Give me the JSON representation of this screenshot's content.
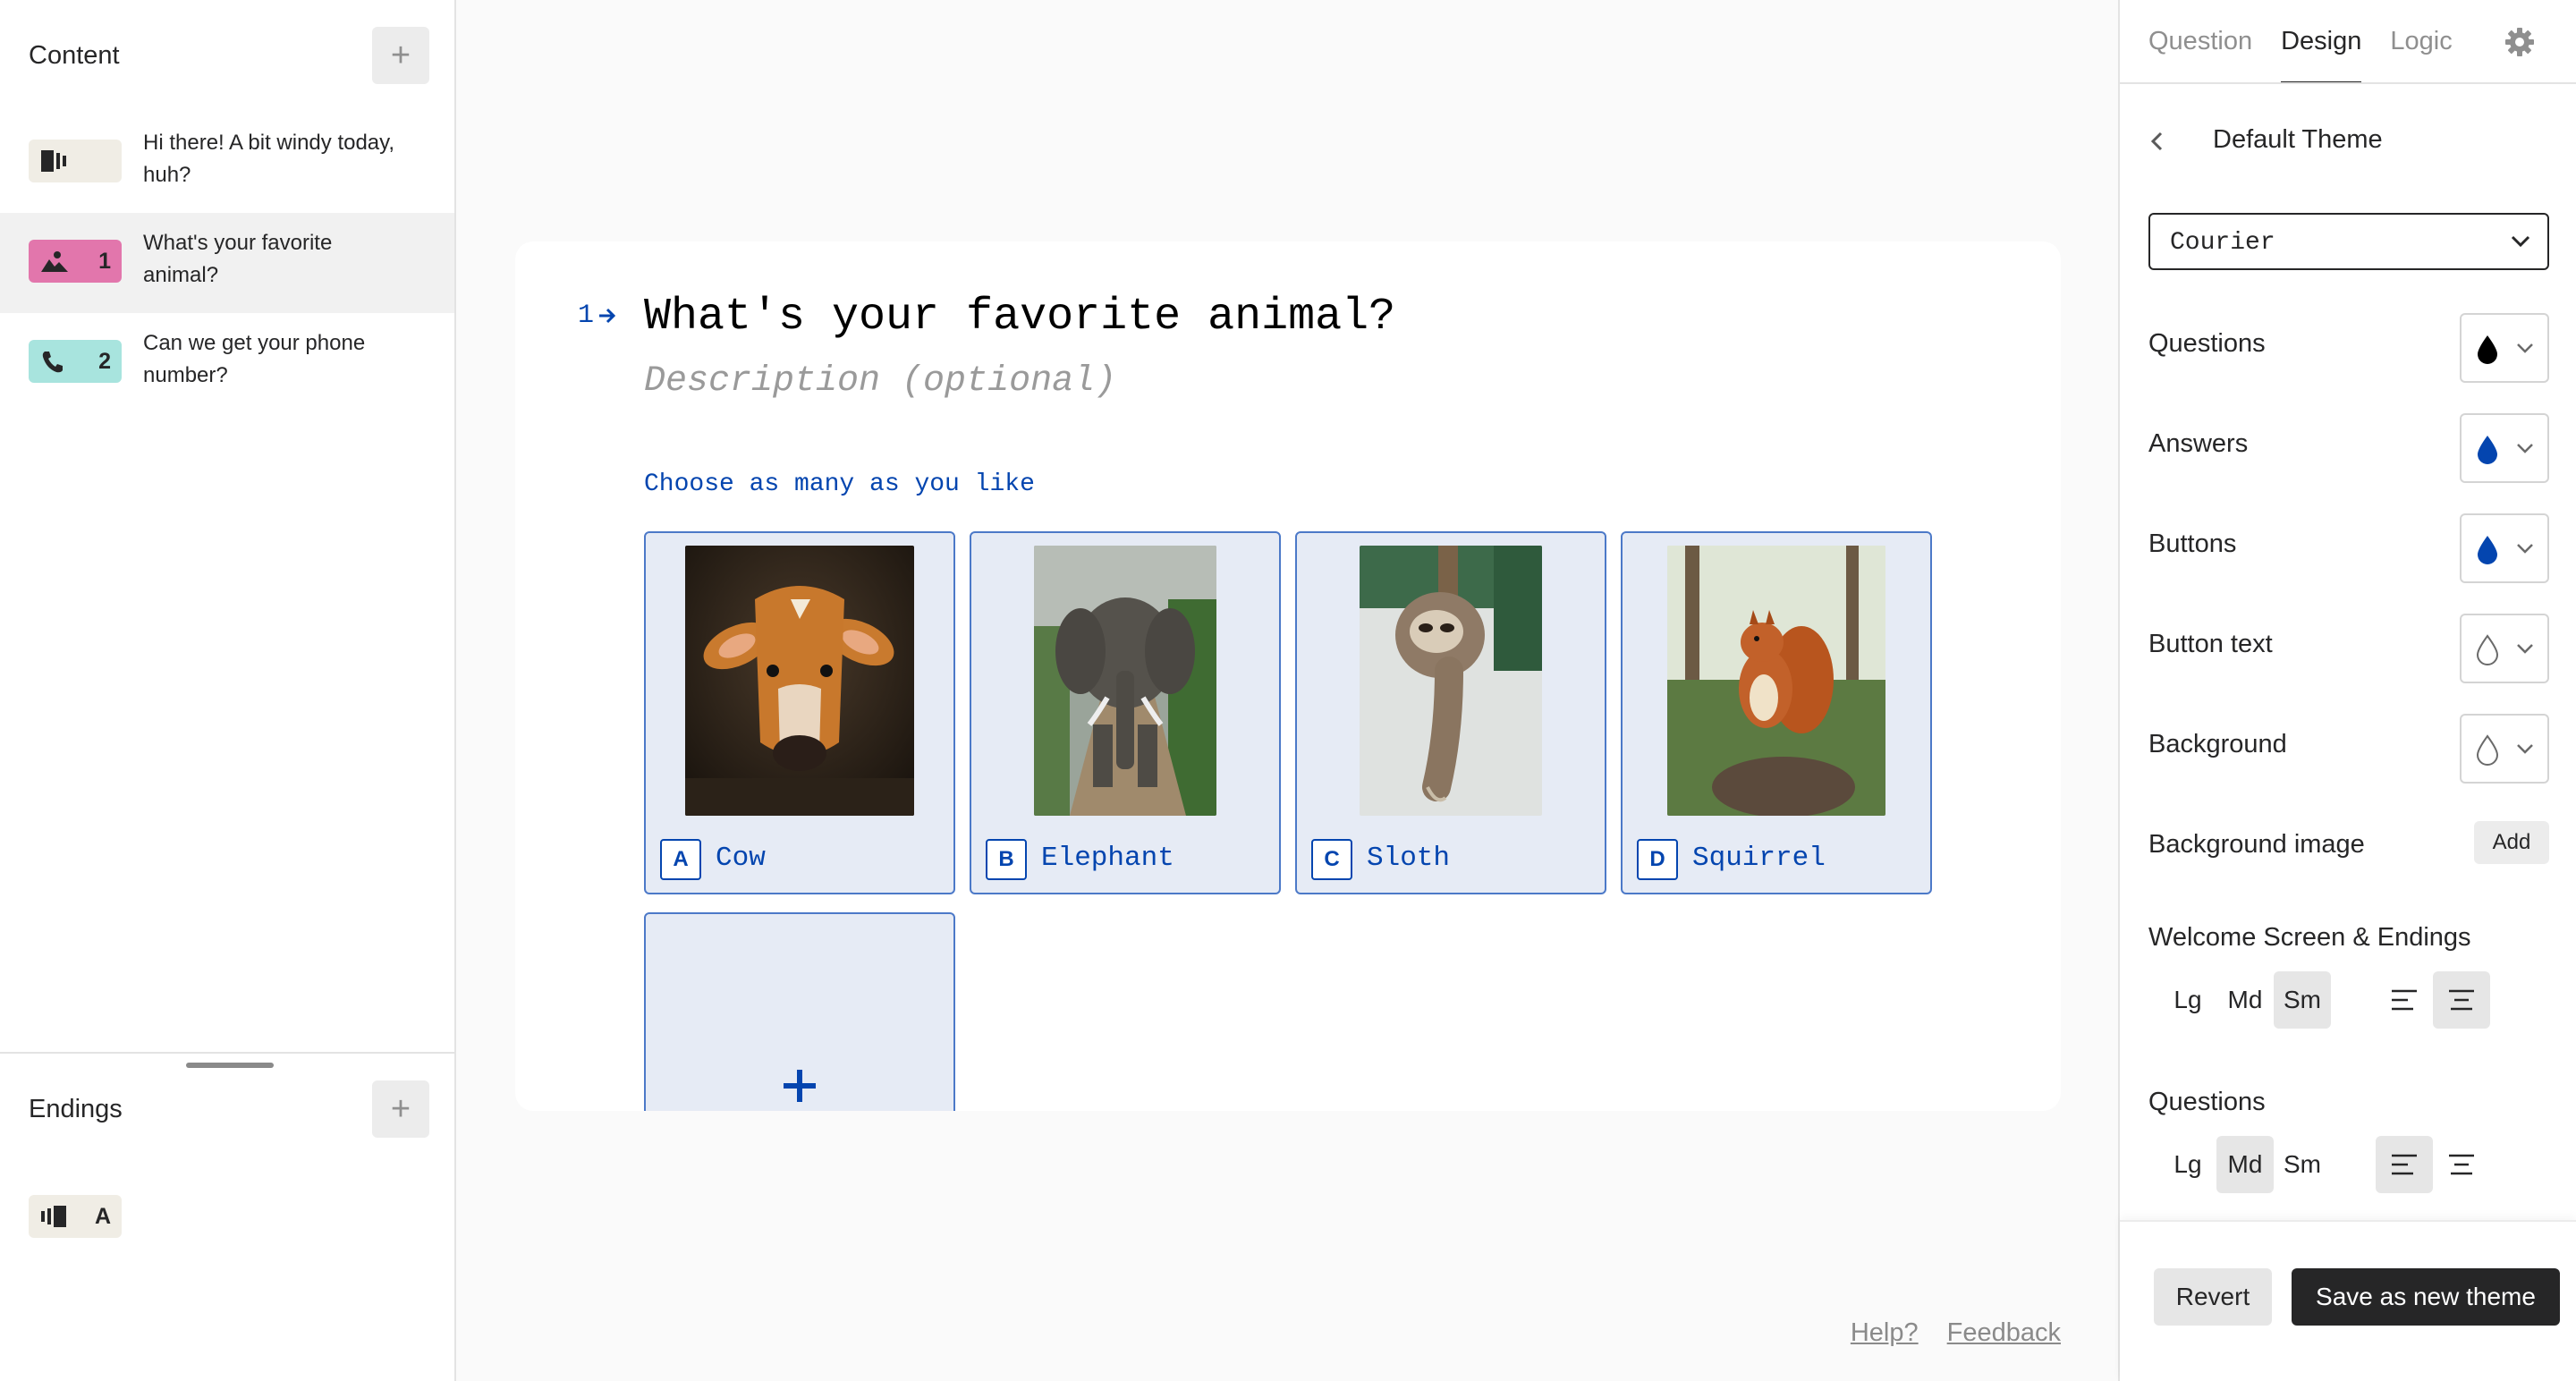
{
  "sidebar": {
    "content_title": "Content",
    "add_label": "+",
    "items": [
      {
        "number": "",
        "text": "Hi there! A bit windy today, huh?",
        "type_icon": "welcome-screen-icon",
        "color": "#f0ede5"
      },
      {
        "number": "1",
        "text": "What's your favorite animal?",
        "type_icon": "picture-choice-icon",
        "color": "#e276ac"
      },
      {
        "number": "2",
        "text": "Can we get your phone number?",
        "type_icon": "phone-icon",
        "color": "#a8e4de"
      }
    ],
    "endings_title": "Endings",
    "endings_add_label": "+",
    "ending_item": {
      "label": "A",
      "type_icon": "ending-screen-icon"
    }
  },
  "question": {
    "number": "1",
    "title": "What's your favorite animal?",
    "description_placeholder": "Description (optional)",
    "hint": "Choose as many as you like",
    "choices": [
      {
        "key": "A",
        "label": "Cow",
        "image": "cow-photo"
      },
      {
        "key": "B",
        "label": "Elephant",
        "image": "elephant-photo"
      },
      {
        "key": "C",
        "label": "Sloth",
        "image": "sloth-photo"
      },
      {
        "key": "D",
        "label": "Squirrel",
        "image": "squirrel-photo"
      }
    ],
    "accent_color": "#0445af"
  },
  "footer": {
    "help": "Help?",
    "feedback": "Feedback"
  },
  "design_panel": {
    "tabs": [
      "Question",
      "Design",
      "Logic"
    ],
    "active_tab": "Design",
    "theme_name": "Default Theme",
    "font": "Courier",
    "colors": [
      {
        "label": "Questions",
        "value": "#000000"
      },
      {
        "label": "Answers",
        "value": "#0445af"
      },
      {
        "label": "Buttons",
        "value": "#0445af"
      },
      {
        "label": "Button text",
        "value": "#ffffff"
      },
      {
        "label": "Background",
        "value": "#ffffff"
      }
    ],
    "background_image_label": "Background image",
    "background_image_add": "Add",
    "welcome_section": "Welcome Screen & Endings",
    "questions_section": "Questions",
    "sizes": [
      "Lg",
      "Md",
      "Sm"
    ],
    "welcome_size_selected": "Sm",
    "welcome_align_selected": "center",
    "questions_size_selected": "Md",
    "questions_align_selected": "left",
    "revert_label": "Revert",
    "save_label": "Save as new theme"
  }
}
